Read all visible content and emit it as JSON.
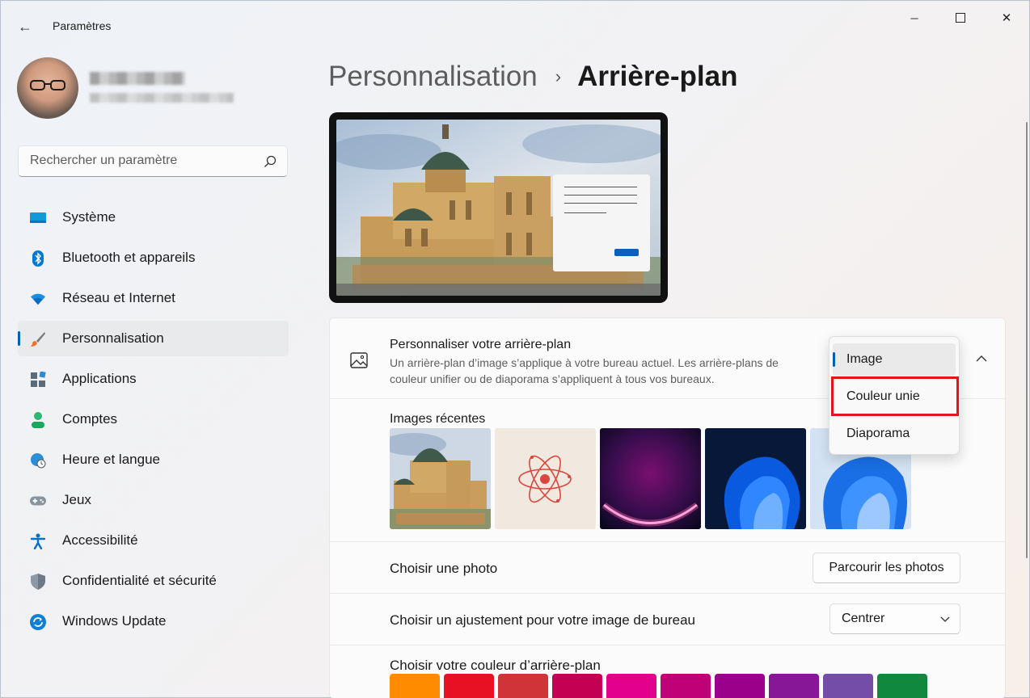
{
  "window": {
    "title": "Paramètres",
    "back_glyph": "←",
    "min_glyph": "─",
    "close_glyph": "✕"
  },
  "search": {
    "placeholder": "Rechercher un paramètre"
  },
  "sidebar": {
    "items": [
      {
        "label": "Système",
        "icon": "system-icon"
      },
      {
        "label": "Bluetooth et appareils",
        "icon": "bluetooth-icon"
      },
      {
        "label": "Réseau et Internet",
        "icon": "wifi-icon"
      },
      {
        "label": "Personnalisation",
        "icon": "brush-icon",
        "active": true
      },
      {
        "label": "Applications",
        "icon": "apps-icon"
      },
      {
        "label": "Comptes",
        "icon": "person-icon"
      },
      {
        "label": "Heure et langue",
        "icon": "globe-clock-icon"
      },
      {
        "label": "Jeux",
        "icon": "gamepad-icon"
      },
      {
        "label": "Accessibilité",
        "icon": "accessibility-icon"
      },
      {
        "label": "Confidentialité et sécurité",
        "icon": "shield-icon"
      },
      {
        "label": "Windows Update",
        "icon": "update-icon"
      }
    ]
  },
  "header": {
    "parent": "Personnalisation",
    "separator": "›",
    "current": "Arrière-plan"
  },
  "background": {
    "title": "Personnaliser votre arrière-plan",
    "description": "Un arrière-plan d’image s’applique à votre bureau actuel. Les arrière-plans de couleur unifier ou de diaporama s’appliquent à tous vos bureaux.",
    "selected_type": "Image",
    "options": [
      "Image",
      "Couleur unie",
      "Diaporama"
    ]
  },
  "recent_images": {
    "label": "Images récentes",
    "items": [
      "cathedral",
      "atom",
      "purple-bloom",
      "blue-bloom-dark",
      "blue-bloom-light"
    ]
  },
  "choose_photo": {
    "label": "Choisir une photo",
    "button": "Parcourir les photos"
  },
  "fit": {
    "label": "Choisir un ajustement pour votre image de bureau",
    "value": "Centrer"
  },
  "color": {
    "label": "Choisir votre couleur d’arrière-plan",
    "swatches": [
      "#ff8c00",
      "#e81123",
      "#d13438",
      "#c30052",
      "#e3008c",
      "#bf0077",
      "#9a0089",
      "#881798",
      "#744da9",
      "#10893e"
    ]
  },
  "colors": {
    "accent": "#005fb8",
    "highlight": "#e0151d"
  }
}
